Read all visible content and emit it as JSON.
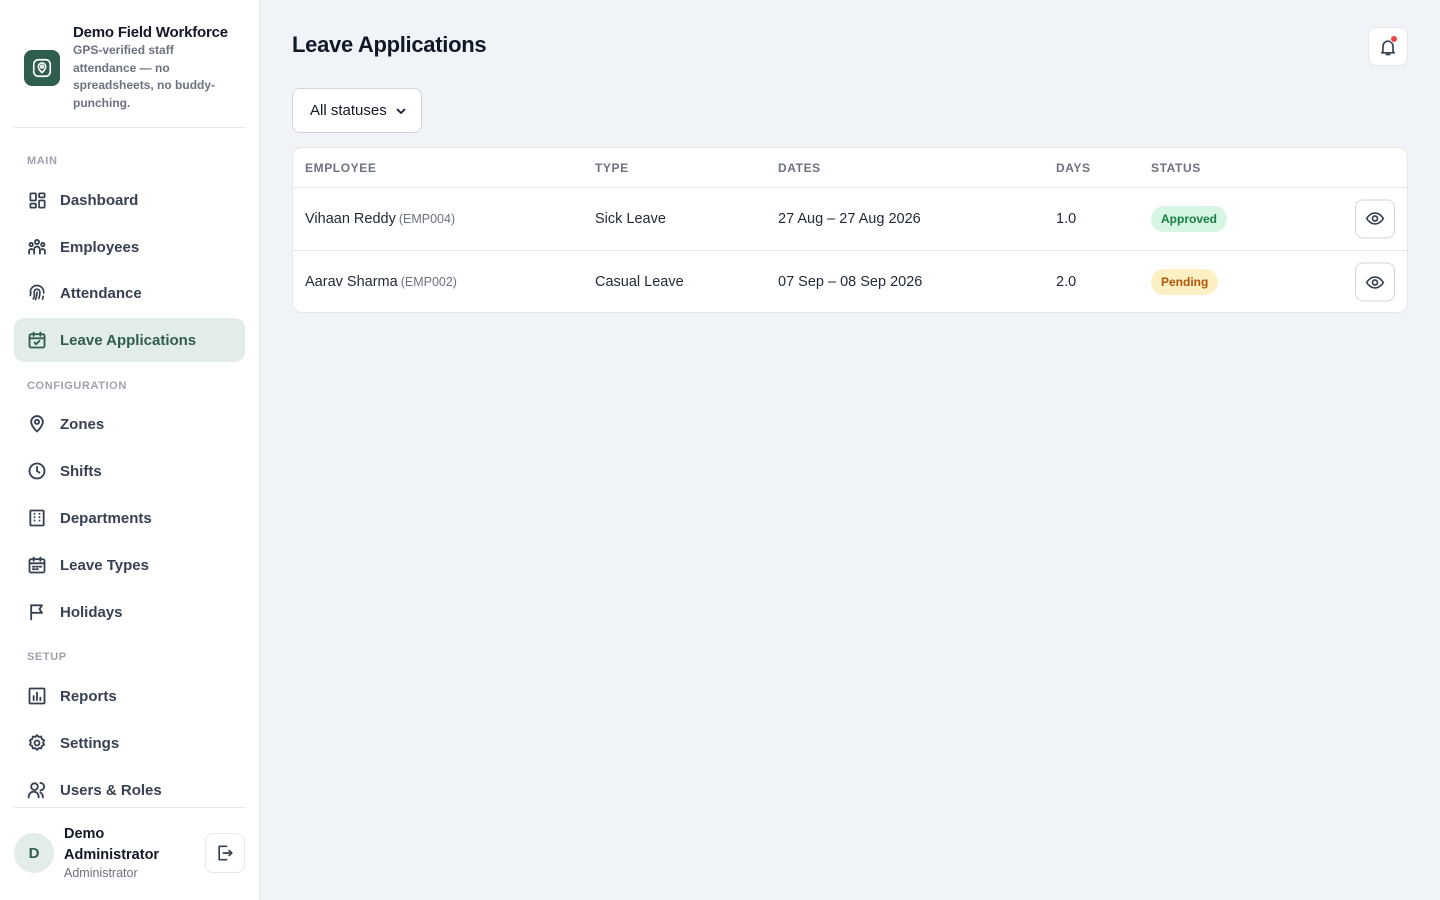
{
  "brand": {
    "title": "Demo Field Workforce",
    "subtitle": "GPS-verified staff attendance — no spreadsheets, no buddy-punching."
  },
  "sidebar": {
    "sections": {
      "main": "MAIN",
      "configuration": "CONFIGURATION",
      "setup": "SETUP"
    },
    "items": [
      {
        "label": "Dashboard",
        "icon": "dashboard-icon"
      },
      {
        "label": "Employees",
        "icon": "people-icon"
      },
      {
        "label": "Attendance",
        "icon": "fingerprint-icon"
      },
      {
        "label": "Leave Applications",
        "icon": "calendar-check-icon",
        "active": true
      },
      {
        "label": "Zones",
        "icon": "map-pin-icon"
      },
      {
        "label": "Shifts",
        "icon": "clock-icon"
      },
      {
        "label": "Departments",
        "icon": "building-icon"
      },
      {
        "label": "Leave Types",
        "icon": "calendar-icon"
      },
      {
        "label": "Holidays",
        "icon": "flag-icon"
      },
      {
        "label": "Reports",
        "icon": "bar-chart-icon"
      },
      {
        "label": "Settings",
        "icon": "gear-icon"
      },
      {
        "label": "Users & Roles",
        "icon": "users-icon"
      }
    ]
  },
  "user": {
    "initial": "D",
    "name": "Demo Administrator",
    "role": "Administrator"
  },
  "page": {
    "title": "Leave Applications"
  },
  "filter": {
    "selected": "All statuses"
  },
  "table": {
    "headers": [
      "EMPLOYEE",
      "TYPE",
      "DATES",
      "DAYS",
      "STATUS"
    ],
    "rows": [
      {
        "name": "Vihaan Reddy",
        "code": "(EMP004)",
        "type": "Sick Leave",
        "dates": "27 Aug – 27 Aug 2026",
        "days": "1.0",
        "status": "Approved"
      },
      {
        "name": "Aarav Sharma",
        "code": "(EMP002)",
        "type": "Casual Leave",
        "dates": "07 Sep – 08 Sep 2026",
        "days": "2.0",
        "status": "Pending"
      }
    ]
  },
  "colors": {
    "accent": "#2f5d4e",
    "approved": "#15803d",
    "pending": "#b45309",
    "notification": "#ef4444"
  }
}
